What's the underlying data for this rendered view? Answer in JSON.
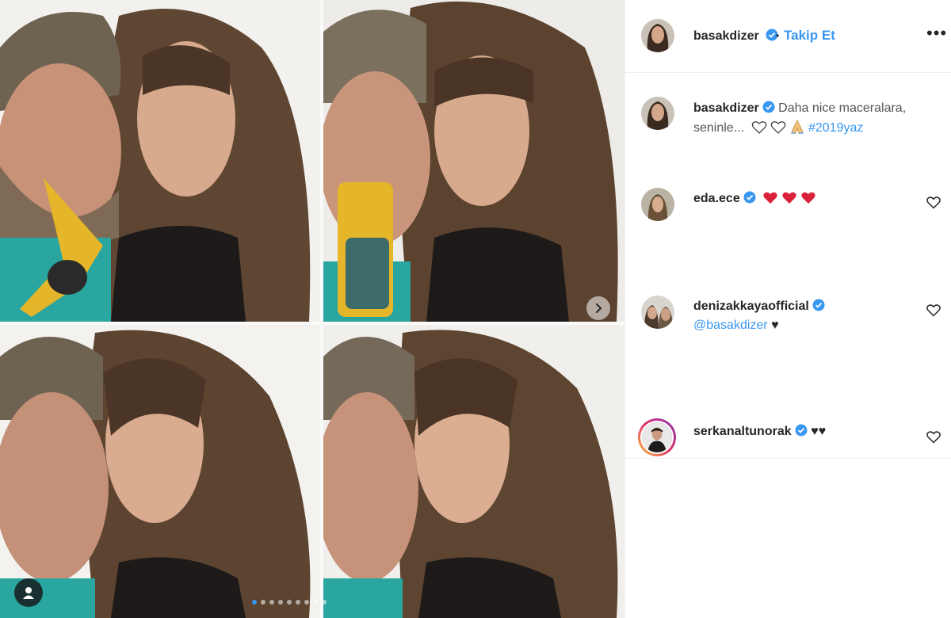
{
  "post": {
    "author": "basakdizer",
    "follow_label": "Takip Et",
    "separator": "•",
    "more_label": "•••",
    "caption_text": "Daha nice maceralara, seninle...",
    "hashtag": "#2019yaz",
    "photo_count": 9,
    "active_photo": 0
  },
  "comments": [
    {
      "username": "eda.ece",
      "text": ""
    },
    {
      "username": "denizakkayaofficial",
      "mention": "@basakdizer",
      "text": "♥"
    },
    {
      "username": "serkanaltunorak",
      "text": "♥♥"
    }
  ],
  "colors": {
    "link": "#3897f0",
    "verified": "#3897f0",
    "heart_emoji": "#d9223a"
  },
  "icons": [
    "verified-badge-icon",
    "heart-outline-icon",
    "red-heart-emoji-icon",
    "praying-hands-emoji-icon",
    "chevron-right-icon",
    "user-tag-icon"
  ]
}
